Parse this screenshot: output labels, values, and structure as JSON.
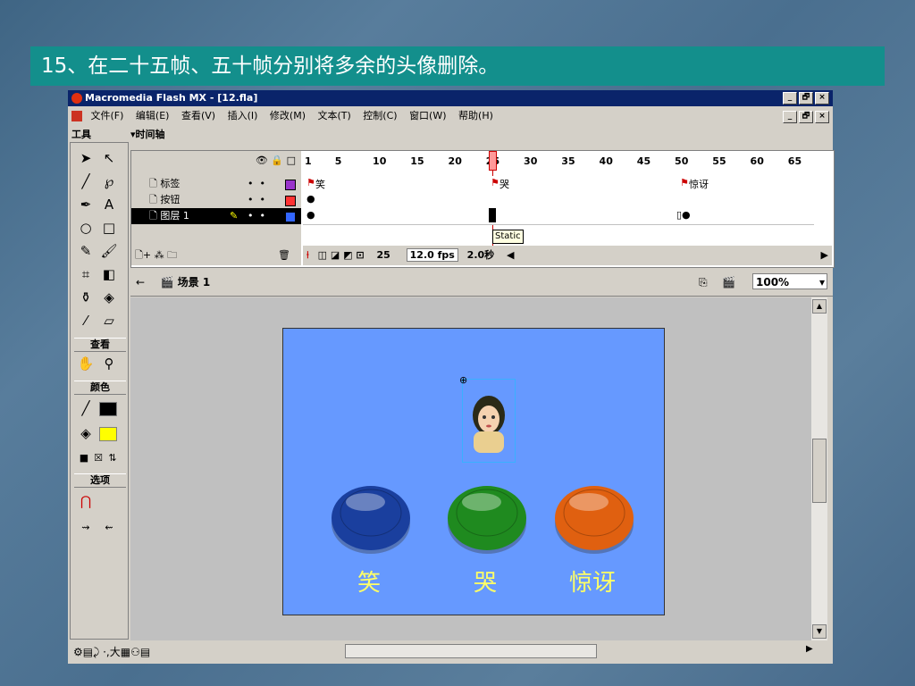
{
  "heading": "15、在二十五帧、五十帧分别将多余的头像删除。",
  "window": {
    "title": "Macromedia Flash MX - [12.fla]",
    "menu": [
      "文件(F)",
      "编辑(E)",
      "查看(V)",
      "插入(I)",
      "修改(M)",
      "文本(T)",
      "控制(C)",
      "窗口(W)",
      "帮助(H)"
    ],
    "min": "_",
    "max": "🗗",
    "close": "×"
  },
  "tools_panel": {
    "title": "工具",
    "view_label": "查看",
    "colors_label": "颜色",
    "options_label": "选项"
  },
  "timeline": {
    "title": "▾时间轴",
    "ruler": [
      "1",
      "5",
      "10",
      "15",
      "20",
      "25",
      "30",
      "35",
      "40",
      "45",
      "50",
      "55",
      "60",
      "65"
    ],
    "layers": [
      {
        "name": "标签",
        "color": "#9933cc"
      },
      {
        "name": "按钮",
        "color": "#ff3333"
      },
      {
        "name": "图层 1",
        "color": "#3366ff"
      }
    ],
    "frame_labels": [
      "笑",
      "哭",
      "惊讶"
    ],
    "current_frame": "25",
    "fps": "12.0 fps",
    "elapsed": "2.0秒",
    "tooltip": "Static"
  },
  "scene": {
    "name": "场景 1",
    "zoom": "100%"
  },
  "stage": {
    "buttons": [
      {
        "label": "笑",
        "color": "#1a3f9e"
      },
      {
        "label": "哭",
        "color": "#1f8a1f"
      },
      {
        "label": "惊讶",
        "color": "#e06010"
      }
    ]
  }
}
